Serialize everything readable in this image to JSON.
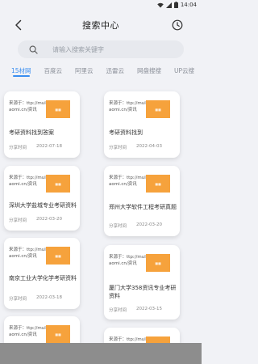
{
  "status": {
    "time": "14:04"
  },
  "header": {
    "title": "搜索中心"
  },
  "search": {
    "placeholder": "请输入搜索关键字"
  },
  "tabs": [
    {
      "label": "15材网"
    },
    {
      "label": "百度云"
    },
    {
      "label": "阿里云"
    },
    {
      "label": "迅雷云"
    },
    {
      "label": "网盘搜搜"
    },
    {
      "label": "UP云搜"
    }
  ],
  "cards": [
    {
      "source": "来源于：ttp://mulaomi.cn/资讯",
      "title": "考研资料找到答案",
      "author": "分享时间",
      "date": "2022-07-18"
    },
    {
      "source": "来源于：ttp://mulaomi.cn/资讯",
      "title": "考研资料找到",
      "author": "分享时间",
      "date": "2022-04-03"
    },
    {
      "source": "来源于：ttp://mulaomi.cn/资讯",
      "title": "深圳大学盐城专业考研资料",
      "author": "分享时间",
      "date": "2022-03-20"
    },
    {
      "source": "来源于：ttp://mulaomi.cn/资讯",
      "title": "郑州大学软件工程考研真题",
      "author": "分享时间",
      "date": "2022-03-20"
    },
    {
      "source": "来源于：ttp://mulaomi.cn/资讯",
      "title": "南京工业大学化学考研资料",
      "author": "分享时间",
      "date": "2022-03-18"
    },
    {
      "source": "来源于：ttp://mulaomi.cn/资讯",
      "title": "厦门大学358资讯专业考研资料",
      "author": "分享时间",
      "date": "2022-03-15"
    },
    {
      "source": "来源于：ttp://mulaomi.cn/资讯",
      "title": "",
      "author": "",
      "date": ""
    },
    {
      "source": "来源于：ttp://mulaomi.cn/资讯",
      "title": "",
      "author": "",
      "date": ""
    }
  ],
  "colors": {
    "accent": "#3a8ef0",
    "thumb": "#f6a23c",
    "background": "#f1f2f6"
  },
  "icons": {
    "back": "chevron-left-icon",
    "history": "clock-icon",
    "search": "search-icon"
  }
}
